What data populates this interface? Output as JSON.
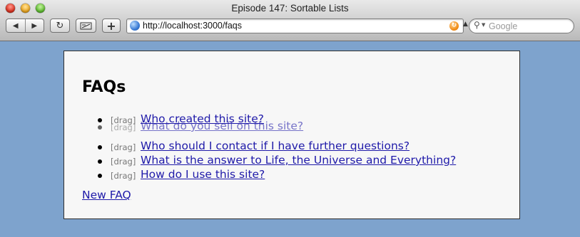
{
  "window": {
    "title": "Episode 147: Sortable Lists"
  },
  "toolbar": {
    "back_icon": "back-arrow-icon",
    "forward_icon": "forward-arrow-icon",
    "reload_icon": "reload-icon",
    "snapback_icon": "snapback-icon",
    "add_icon": "plus-icon",
    "url": "http://localhost:3000/faqs",
    "search_placeholder": "Google"
  },
  "page": {
    "title": "FAQs",
    "drag_label": "[drag]",
    "faqs": [
      {
        "question": "Who created this site?"
      },
      {
        "question": "What do you sell on this site?",
        "state": "dragging"
      },
      {
        "question": "Who should I contact if I have further questions?"
      },
      {
        "question": "What is the answer to Life, the Universe and Everything?"
      },
      {
        "question": "How do I use this site?"
      }
    ],
    "new_link": "New FAQ"
  },
  "colors": {
    "desktop_background": "#7ea3cd",
    "link": "#1f1aa9",
    "content_background": "#f7f7f7"
  }
}
